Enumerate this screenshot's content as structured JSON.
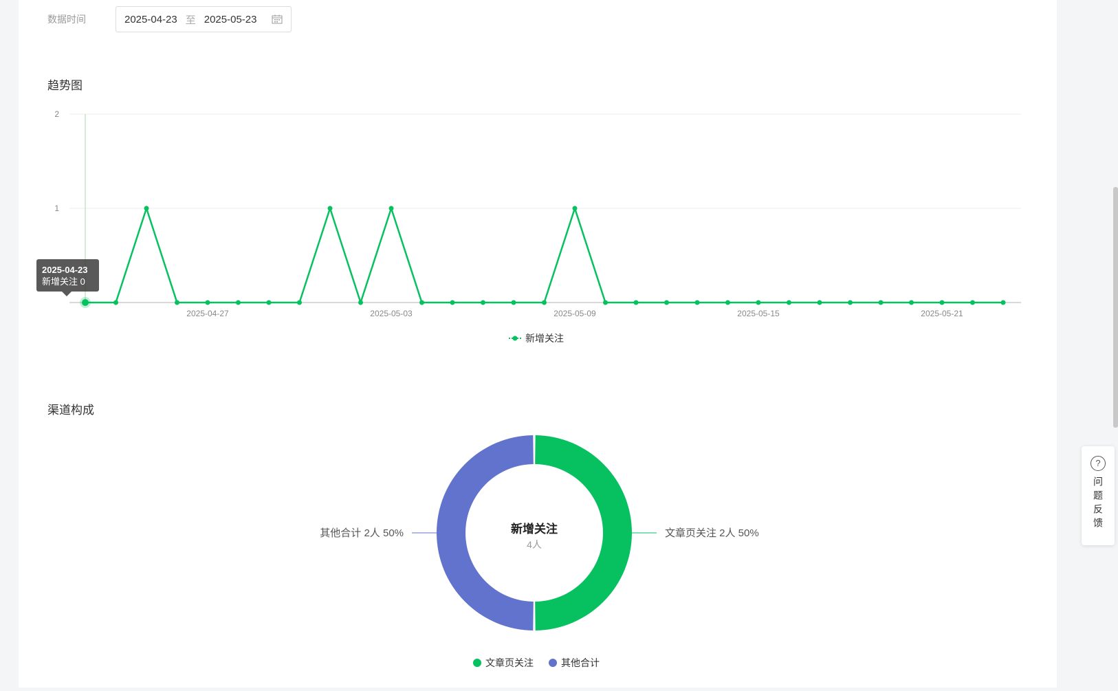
{
  "filter": {
    "label": "数据时间",
    "start_date": "2025-04-23",
    "separator": "至",
    "end_date": "2025-05-23"
  },
  "trend": {
    "title": "趋势图"
  },
  "channel": {
    "title": "渠道构成"
  },
  "tooltip": {
    "date": "2025-04-23",
    "text": "新增关注 0"
  },
  "feedback": {
    "label": "问题反馈"
  },
  "colors": {
    "green": "#07c160",
    "blue": "#6173cc"
  },
  "chart_data": [
    {
      "type": "line",
      "x": [
        "2025-04-23",
        "2025-04-24",
        "2025-04-25",
        "2025-04-26",
        "2025-04-27",
        "2025-04-28",
        "2025-04-29",
        "2025-04-30",
        "2025-05-01",
        "2025-05-02",
        "2025-05-03",
        "2025-05-04",
        "2025-05-05",
        "2025-05-06",
        "2025-05-07",
        "2025-05-08",
        "2025-05-09",
        "2025-05-10",
        "2025-05-11",
        "2025-05-12",
        "2025-05-13",
        "2025-05-14",
        "2025-05-15",
        "2025-05-16",
        "2025-05-17",
        "2025-05-18",
        "2025-05-19",
        "2025-05-20",
        "2025-05-21",
        "2025-05-22",
        "2025-05-23"
      ],
      "x_tick_labels": [
        "2025-04-27",
        "2025-05-03",
        "2025-05-09",
        "2025-05-15",
        "2025-05-21"
      ],
      "y_ticks": [
        "1",
        "2"
      ],
      "series": [
        {
          "name": "新增关注",
          "values": [
            0,
            0,
            1,
            0,
            0,
            0,
            0,
            0,
            1,
            0,
            1,
            0,
            0,
            0,
            0,
            0,
            1,
            0,
            0,
            0,
            0,
            0,
            0,
            0,
            0,
            0,
            0,
            0,
            0,
            0,
            0
          ]
        }
      ],
      "ylim": [
        0,
        2
      ],
      "grid": true,
      "legend": "bottom-center"
    },
    {
      "type": "pie",
      "donut": true,
      "center_title": "新增关注",
      "center_value": "4人",
      "slices": [
        {
          "name": "文章页关注",
          "value": 2,
          "label": "文章页关注 2人 50%"
        },
        {
          "name": "其他合计",
          "value": 2,
          "label": "其他合计 2人 50%"
        }
      ],
      "legend": "bottom-center"
    }
  ]
}
